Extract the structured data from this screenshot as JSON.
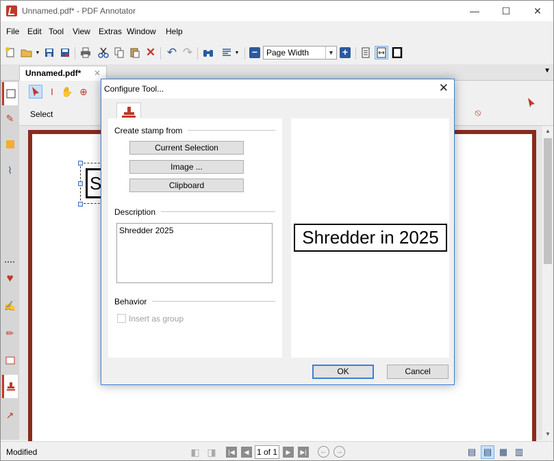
{
  "window": {
    "title": "Unnamed.pdf* - PDF Annotator",
    "minimize": "—",
    "maximize": "☐",
    "close": "✕"
  },
  "menu": [
    "File",
    "Edit",
    "Tool",
    "View",
    "Extras",
    "Window",
    "Help"
  ],
  "toolbar": {
    "zoom_value": "Page Width",
    "icons": [
      "new-doc",
      "open-folder",
      "save",
      "save-as",
      "print",
      "cut",
      "copy",
      "paste",
      "delete",
      "undo",
      "redo",
      "find",
      "page-setup",
      "zoom-out",
      "zoom-in",
      "single-page",
      "fit-width",
      "full-screen"
    ]
  },
  "tabs": {
    "document": "Unnamed.pdf*",
    "close": "✕"
  },
  "tool_panel": {
    "select_label": "Select"
  },
  "document": {
    "stamp_preview_text": "Sh"
  },
  "status": {
    "text": "Modified",
    "page_indicator": "1 of 1"
  },
  "dialog": {
    "title": "Configure Tool...",
    "create_from_label": "Create stamp from",
    "buttons": {
      "current_selection": "Current Selection",
      "image": "Image ...",
      "clipboard": "Clipboard"
    },
    "description_label": "Description",
    "description_value": "Shredder 2025",
    "behavior_label": "Behavior",
    "insert_as_group": "Insert as group",
    "insert_as_group_checked": false,
    "preview_text": "Shredder in 2025",
    "ok": "OK",
    "cancel": "Cancel"
  },
  "colors": {
    "accent_red": "#c0392b",
    "page_border": "#8a2a1e",
    "dialog_border": "#3c7fd6",
    "active_button": "#c9e0f7"
  }
}
